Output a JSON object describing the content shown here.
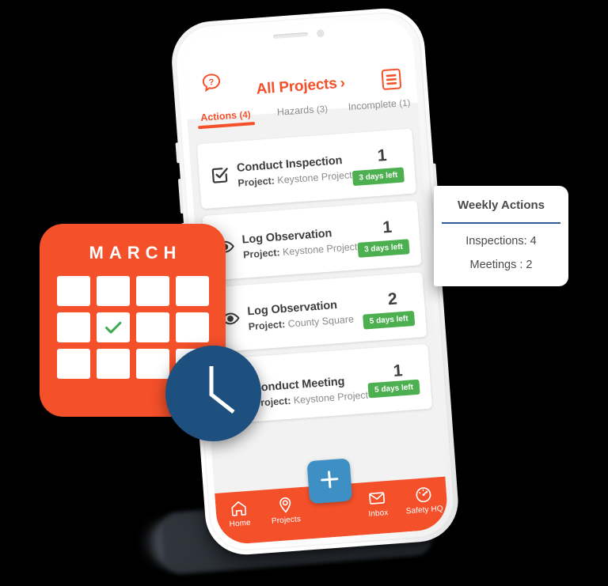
{
  "colors": {
    "brand_orange": "#F4502A",
    "accent_blue": "#3D8FC4",
    "clock_blue": "#1D4F7F",
    "badge_green": "#4CAF50",
    "divider_blue": "#2D5D94",
    "background": "#000000",
    "screen_bg": "#F2F2F2"
  },
  "app": {
    "header": {
      "help_icon": "question-speech-bubble-icon",
      "title": "All Projects",
      "chevron": "›",
      "menu_icon": "document-list-icon"
    },
    "tabs": [
      {
        "label": "Actions",
        "count": "(4)",
        "active": true
      },
      {
        "label": "Hazards",
        "count": "(3)",
        "active": false
      },
      {
        "label": "Incomplete",
        "count": "(1)",
        "active": false
      }
    ],
    "cards": [
      {
        "icon": "checkbox-checked-icon",
        "title": "Conduct Inspection",
        "project_label": "Project:",
        "project_name": "Keystone Project",
        "count": "1",
        "badge": "3 days left"
      },
      {
        "icon": "eye-icon",
        "title": "Log Observation",
        "project_label": "Project:",
        "project_name": "Keystone Project",
        "count": "1",
        "badge": "3 days left"
      },
      {
        "icon": "eye-icon",
        "title": "Log Observation",
        "project_label": "Project:",
        "project_name": "County Square",
        "count": "2",
        "badge": "5 days left"
      },
      {
        "icon": "eye-icon",
        "title": "Conduct Meeting",
        "project_label": "Project:",
        "project_name": "Keystone Project",
        "count": "1",
        "badge": "5 days left"
      }
    ],
    "bottom_nav": {
      "items": [
        {
          "label": "Home",
          "icon": "home-icon"
        },
        {
          "label": "Projects",
          "icon": "map-pin-icon"
        },
        {
          "label": "Inbox",
          "icon": "envelope-icon"
        },
        {
          "label": "Safety HQ",
          "icon": "gauge-icon"
        }
      ],
      "fab": {
        "icon": "plus-icon",
        "label": "+"
      }
    }
  },
  "calendar": {
    "month": "MARCH",
    "rows": 3,
    "cols": 4,
    "checked_cell": {
      "row": 2,
      "col": 2
    },
    "check_icon": "green-check-icon"
  },
  "clock": {
    "icon": "clock-icon"
  },
  "weekly_panel": {
    "title": "Weekly Actions",
    "rows": [
      "Inspections: 4",
      "Meetings : 2"
    ]
  }
}
